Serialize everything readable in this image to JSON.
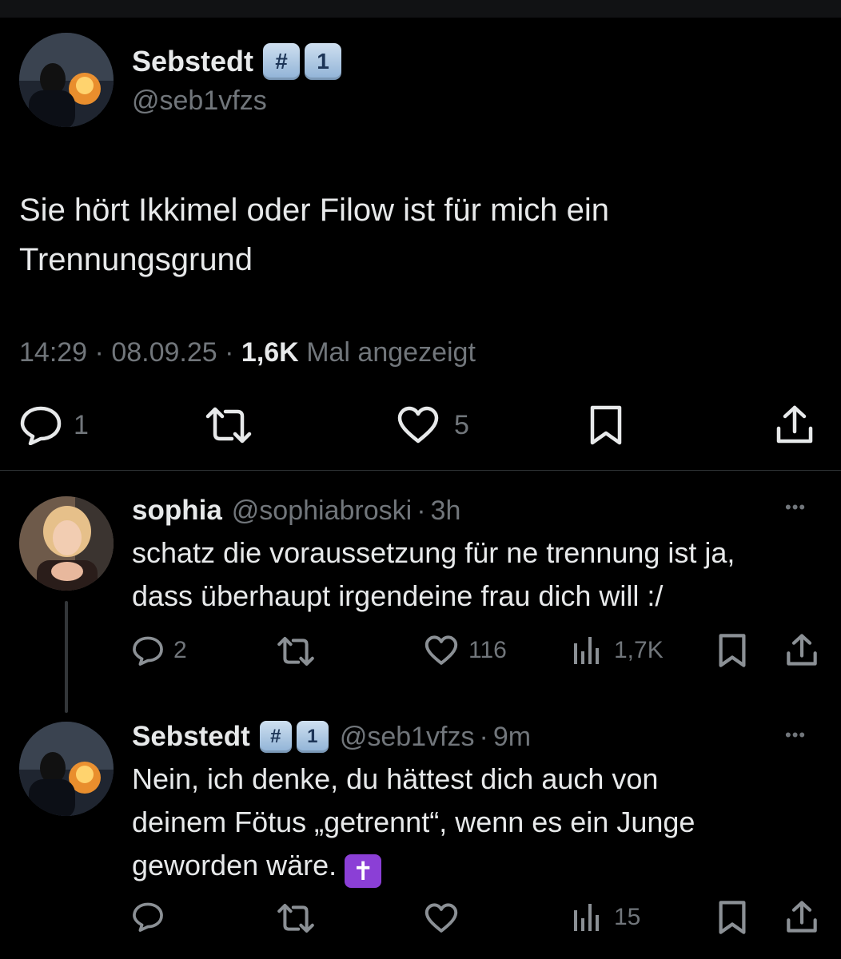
{
  "main_tweet": {
    "author_name": "Sebstedt",
    "badge_1": "#",
    "badge_2": "1",
    "handle": "@seb1vfzs",
    "text_line_1": "Sie hört Ikkimel oder Filow ist für mich ein",
    "text_line_2": "Trennungsgrund",
    "time": "14:29",
    "date": "08.09.25",
    "views": "1,6K",
    "views_label": "Mal angezeigt",
    "reply_count": "1",
    "like_count": "5"
  },
  "reply_1": {
    "author_name": "sophia",
    "handle": "@sophiabroski",
    "age": "3h",
    "text_line_1": "schatz die voraussetzung für ne trennung ist ja,",
    "text_line_2": "dass überhaupt irgendeine frau dich will :/",
    "reply_count": "2",
    "like_count": "116",
    "view_count": "1,7K",
    "more_label": "•••"
  },
  "reply_2": {
    "author_name": "Sebstedt",
    "badge_1": "#",
    "badge_2": "1",
    "handle": "@seb1vfzs",
    "age": "9m",
    "text_line_1": "Nein, ich denke, du hättest dich auch von",
    "text_line_2": "deinem Fötus „getrennt“, wenn es ein Junge",
    "text_line_3": "geworden wäre.",
    "emoji": "✝",
    "view_count": "15",
    "more_label": "•••"
  },
  "separator": "·",
  "colors": {
    "background": "#000000",
    "text": "#e7e9ea",
    "muted": "#71767b",
    "divider": "#2f3336",
    "badge_blue": "#8fb2d6",
    "cross_purple": "#8b3fd6"
  }
}
